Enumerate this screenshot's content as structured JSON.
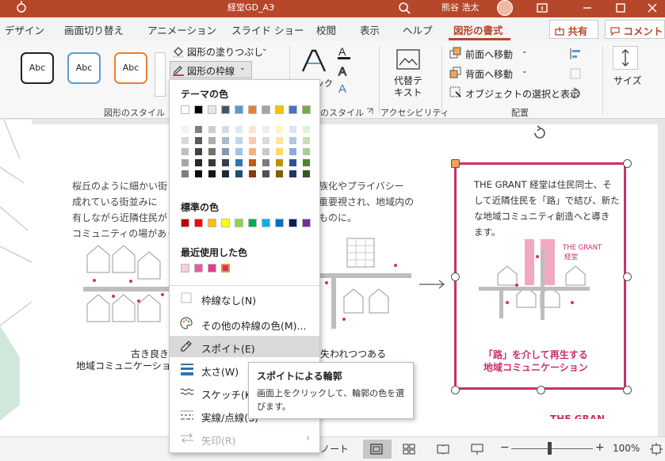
{
  "titlebar": {
    "doc_title": "経堂GD_A3",
    "doc_sep": "-",
    "user": "熊谷 浩太"
  },
  "tabs": [
    "デザイン",
    "画面切り替え",
    "アニメーション",
    "スライド ショー",
    "校閲",
    "表示",
    "ヘルプ",
    "図形の書式"
  ],
  "share_label": "共有",
  "comment_label": "コメント",
  "ribbon": {
    "style_sample": "Abc",
    "fill_label": "図形の塗りつぶし",
    "outline_label": "図形の枠線",
    "quick_label": "クイック",
    "alt_text_label": "代替テ\nキスト",
    "bring_forward_label": "前面へ移動",
    "send_backward_label": "背面へ移動",
    "selection_pane_label": "オブジェクトの選択と表示",
    "size_label": "サイズ",
    "groups": {
      "shape_styles": "図形のスタイル",
      "wordart_styles": "のスタイル",
      "accessibility": "アクセシビリティ",
      "arrange": "配置"
    }
  },
  "slide": {
    "para1": [
      "桜丘のように細かい街",
      "成れている街並みに",
      "有しながら近隣住民が",
      "コミュニティの場があっ"
    ],
    "para2": [
      "族化やプライバシー",
      "重要視され、地域内の",
      "ものに。"
    ],
    "caption_left": [
      "古き良き",
      "地域コミュニケーショ"
    ],
    "caption_mid": "失われつつある",
    "grant_text": [
      "THE GRANT 経堂は住民同士、そ",
      "して近隣住民を「路」で結び、新た",
      "な地域コミュニティ創造へと導き",
      "ます。"
    ],
    "grant_label": [
      "THE GRANT",
      "経堂"
    ],
    "grant_caption": [
      "「路」を介して再生する",
      "地域コミュニケーション"
    ],
    "bottom_text": "THE GRAN"
  },
  "menu": {
    "theme_colors_header": "テーマの色",
    "standard_colors_header": "標準の色",
    "recent_colors_header": "最近使用した色",
    "items": [
      {
        "label": "枠線なし(N)",
        "icon": "square-outline-icon"
      },
      {
        "label": "その他の枠線の色(M)...",
        "icon": "palette-icon"
      },
      {
        "label": "スポイト(E)",
        "icon": "eyedropper-icon"
      },
      {
        "label": "太さ(W)",
        "icon": "line-weight-icon"
      },
      {
        "label": "スケッチ(K)",
        "icon": "sketch-line-icon"
      },
      {
        "label": "実線/点線(S)",
        "icon": "dash-line-icon"
      },
      {
        "label": "矢印(R)",
        "icon": "arrow-line-icon"
      }
    ],
    "theme_top": [
      "#ffffff",
      "#000000",
      "#e7e6e6",
      "#44546a",
      "#5b9bd5",
      "#ed7d31",
      "#a5a5a5",
      "#ffc000",
      "#4472c4",
      "#70ad47"
    ],
    "theme_shades": [
      [
        "#f2f2f2",
        "#808080",
        "#d0cece",
        "#d6dce4",
        "#deebf6",
        "#fbe5d5",
        "#ededed",
        "#fff2cc",
        "#dae3f3",
        "#e2efd9"
      ],
      [
        "#d9d9d9",
        "#595959",
        "#aeabab",
        "#adb9ca",
        "#bdd7ee",
        "#f7cbac",
        "#dbdbdb",
        "#fee599",
        "#b4c6e7",
        "#c5e0b3"
      ],
      [
        "#bfbfbf",
        "#404040",
        "#757070",
        "#8496b0",
        "#9cc3e5",
        "#f4b183",
        "#c9c9c9",
        "#ffd965",
        "#8eaadb",
        "#a8d08d"
      ],
      [
        "#a6a6a6",
        "#262626",
        "#3a3838",
        "#323f4f",
        "#2e75b5",
        "#c55a11",
        "#7b7b7b",
        "#bf9000",
        "#2f5496",
        "#538135"
      ],
      [
        "#7f7f7f",
        "#0d0d0d",
        "#171616",
        "#222a35",
        "#1f4e79",
        "#833c0b",
        "#525252",
        "#7f6000",
        "#1f3864",
        "#375623"
      ]
    ],
    "standard": [
      "#c00000",
      "#ff0000",
      "#ffc000",
      "#ffff00",
      "#92d050",
      "#00b050",
      "#00b0f0",
      "#0070c0",
      "#002060",
      "#7030a0"
    ],
    "recent": [
      "#f7d0de",
      "#e75a9c",
      "#de3f86",
      "#d32e7a"
    ]
  },
  "tooltip": {
    "title": "スポイトによる輪郭",
    "body": [
      "画面上をクリックして、輪郭の色を選",
      "びます。"
    ]
  },
  "status": {
    "notes": "ノート",
    "zoom_minus": "−",
    "zoom_plus": "+",
    "zoom": "100%"
  },
  "colors": {
    "accent": "#b7472a",
    "pink": "#c9306e"
  }
}
